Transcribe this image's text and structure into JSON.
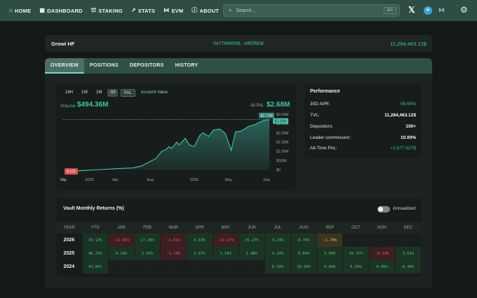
{
  "nav": {
    "items": [
      {
        "icon": "⌂",
        "label": "HOME"
      },
      {
        "icon": "▦",
        "label": "DASHBOARD"
      },
      {
        "icon": "⛫",
        "label": "STAKING"
      },
      {
        "icon": "↗",
        "label": "STATS"
      },
      {
        "icon": "⋈",
        "label": "EVM"
      },
      {
        "icon": "ⓘ",
        "label": "ABOUT"
      }
    ],
    "search_placeholder": "Search...",
    "search_shortcut": "⌘K",
    "social": {
      "x": "𝕏",
      "telegram": "➤",
      "github": "⋈"
    },
    "settings_icon": "⚙"
  },
  "vault": {
    "name": "Growi HF",
    "address": "0x77894508...e8f2f60d",
    "tvl": "11,284,463.12$"
  },
  "tabs": [
    "OVERVIEW",
    "POSITIONS",
    "DEPOSITORS",
    "HISTORY"
  ],
  "chart_controls": {
    "ranges": [
      "24H",
      "1W",
      "1M",
      "All"
    ],
    "selected_range": "All",
    "mode": "PnL",
    "alt_mode": "Account Value"
  },
  "summary": {
    "volume_label": "Volume",
    "volume_value": "$494.36M",
    "pnl_label": "All PnL:",
    "pnl_value": "$2.68M"
  },
  "chart_data": {
    "type": "area",
    "series": [
      {
        "values": [
          {
            "x": "2024-10-15",
            "y": -0.12
          },
          {
            "x": "2024-12-01",
            "y": -0.05
          },
          {
            "x": "2025-02-01",
            "y": 0.0
          },
          {
            "x": "2025-04-01",
            "y": 0.05
          },
          {
            "x": "2025-06-01",
            "y": 0.1
          },
          {
            "x": "2025-07-01",
            "y": 0.2
          },
          {
            "x": "2025-08-01",
            "y": 0.45
          },
          {
            "x": "2025-08-20",
            "y": 0.6
          },
          {
            "x": "2025-09-10",
            "y": 1.0
          },
          {
            "x": "2025-09-25",
            "y": 1.1
          },
          {
            "x": "2025-10-05",
            "y": 1.25
          },
          {
            "x": "2025-10-15",
            "y": 1.15
          },
          {
            "x": "2025-11-01",
            "y": 1.5
          },
          {
            "x": "2025-11-10",
            "y": 1.35
          },
          {
            "x": "2025-12-01",
            "y": 1.7
          },
          {
            "x": "2025-12-15",
            "y": 1.35
          },
          {
            "x": "2026-01-01",
            "y": 1.25
          },
          {
            "x": "2026-01-20",
            "y": 1.85
          },
          {
            "x": "2026-02-01",
            "y": 2.0
          },
          {
            "x": "2026-02-20",
            "y": 1.8
          },
          {
            "x": "2026-03-10",
            "y": 2.15
          },
          {
            "x": "2026-04-01",
            "y": 2.2
          },
          {
            "x": "2026-04-20",
            "y": 1.95
          },
          {
            "x": "2026-05-10",
            "y": 1.05
          },
          {
            "x": "2026-05-25",
            "y": 2.05
          },
          {
            "x": "2026-06-15",
            "y": 2.1
          },
          {
            "x": "2026-07-10",
            "y": 2.35
          },
          {
            "x": "2026-08-01",
            "y": 2.45
          },
          {
            "x": "2026-08-20",
            "y": 2.6
          },
          {
            "x": "2026-09-10",
            "y": 2.71
          },
          {
            "x": "2026-09-20",
            "y": 2.68
          }
        ]
      }
    ],
    "x_ticks": [
      "Sep",
      "2025",
      "Apr",
      "Aug",
      "2026",
      "May",
      "Sep"
    ],
    "y_ticks": [
      "$3.00M",
      "$2.50M",
      "$2.00M",
      "$1.50M",
      "$1.00M",
      "$500K",
      "$0"
    ],
    "ylim": [
      -0.15,
      3.0
    ],
    "high_label": "$2.71M",
    "current_label": "$2.68M",
    "low_label": "$-121",
    "low_marker": "W",
    "reference_line": 2.71,
    "colors": {
      "line": "#37c9ad",
      "fill": "#2e6b5f",
      "low": "#d94f4f"
    }
  },
  "performance": {
    "title": "Performance",
    "rows": [
      {
        "label": "30D APR:",
        "value": "56.68%",
        "style": "green"
      },
      {
        "label": "TVL:",
        "value": "11,284,463.12$",
        "style": "bold"
      },
      {
        "label": "Depositors:",
        "value": "100+",
        "style": "bold"
      },
      {
        "label": "Leader commission:",
        "value": "10.00%",
        "style": "bold"
      },
      {
        "label": "All-Time PnL:",
        "value": "+2,677,627$",
        "style": "green"
      }
    ]
  },
  "returns": {
    "title": "Vault Monthly Returns (%)",
    "toggle_label": "Annualized",
    "headers": [
      "YEAR",
      "YTD",
      "JAN",
      "FEB",
      "MAR",
      "APR",
      "MAY",
      "JUN",
      "JUL",
      "AUG",
      "SEP",
      "OCT",
      "NOV",
      "DEC"
    ],
    "rows": [
      {
        "year": "2026",
        "cells": [
          {
            "v": "10.13%",
            "s": "ytd"
          },
          {
            "v": "-11.81%",
            "s": "neg"
          },
          {
            "v": "17.38%",
            "s": "pos"
          },
          {
            "v": "-1.51%",
            "s": "neg"
          },
          {
            "v": "3.63%",
            "s": "pos"
          },
          {
            "v": "-13.17%",
            "s": "neg"
          },
          {
            "v": "15.27%",
            "s": "pos"
          },
          {
            "v": "3.24%",
            "s": "pos"
          },
          {
            "v": "4.74%",
            "s": "pos"
          },
          {
            "v": "-1.78%",
            "s": "warn"
          },
          {
            "v": "-",
            "s": "empty"
          },
          {
            "v": "-",
            "s": "empty"
          },
          {
            "v": "-",
            "s": "empty"
          }
        ]
      },
      {
        "year": "2025",
        "cells": [
          {
            "v": "40.23%",
            "s": "ytd"
          },
          {
            "v": "4.19%",
            "s": "pos"
          },
          {
            "v": "2.91%",
            "s": "pos"
          },
          {
            "v": "-1.14%",
            "s": "neg"
          },
          {
            "v": "2.67%",
            "s": "pos"
          },
          {
            "v": "1.19%",
            "s": "pos"
          },
          {
            "v": "1.48%",
            "s": "pos"
          },
          {
            "v": "3.20%",
            "s": "pos"
          },
          {
            "v": "0.64%",
            "s": "pos"
          },
          {
            "v": "1.09%",
            "s": "pos"
          },
          {
            "v": "15.37%",
            "s": "pos"
          },
          {
            "v": "-0.19%",
            "s": "neg"
          },
          {
            "v": "3.61%",
            "s": "pos"
          }
        ]
      },
      {
        "year": "2024",
        "cells": [
          {
            "v": "43.85%",
            "s": "ytd"
          },
          {
            "v": "-",
            "s": "empty"
          },
          {
            "v": "-",
            "s": "empty"
          },
          {
            "v": "-",
            "s": "empty"
          },
          {
            "v": "-",
            "s": "empty"
          },
          {
            "v": "-",
            "s": "empty"
          },
          {
            "v": "-",
            "s": "empty"
          },
          {
            "v": "0.58%",
            "s": "pos"
          },
          {
            "v": "15.90%",
            "s": "pos"
          },
          {
            "v": "0.66%",
            "s": "pos"
          },
          {
            "v": "5.56%",
            "s": "pos"
          },
          {
            "v": "9.06%",
            "s": "pos"
          },
          {
            "v": "6.49%",
            "s": "pos"
          }
        ]
      }
    ]
  }
}
